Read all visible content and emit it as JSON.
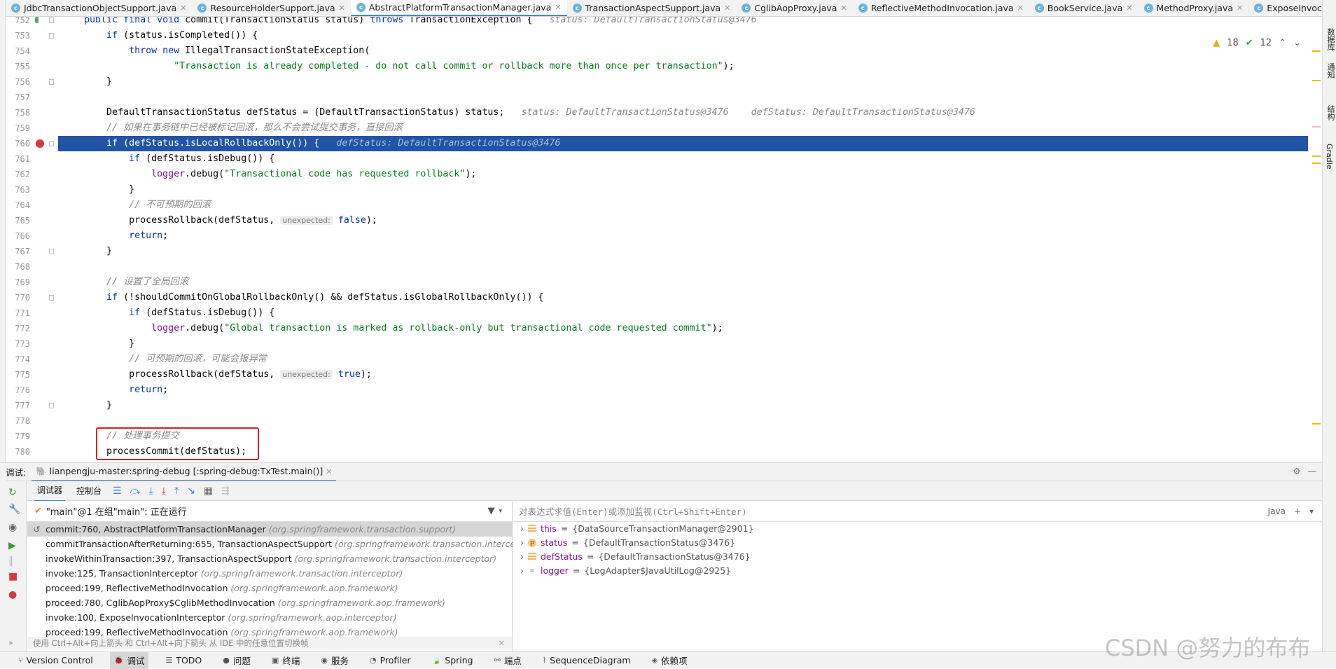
{
  "tabs": [
    {
      "label": "JdbcTransactionObjectSupport.java",
      "active": false
    },
    {
      "label": "ResourceHolderSupport.java",
      "active": false
    },
    {
      "label": "AbstractPlatformTransactionManager.java",
      "active": true
    },
    {
      "label": "TransactionAspectSupport.java",
      "active": false
    },
    {
      "label": "CglibAopProxy.java",
      "active": false
    },
    {
      "label": "ReflectiveMethodInvocation.java",
      "active": false
    },
    {
      "label": "BookService.java",
      "active": false
    },
    {
      "label": "MethodProxy.java",
      "active": false
    },
    {
      "label": "ExposeInvoc",
      "active": false
    }
  ],
  "inspections": {
    "warnings": "18",
    "ok": "12"
  },
  "right_tools": [
    "数据库",
    "通知",
    "结构",
    "Gradle"
  ],
  "editor": {
    "current_line": 760,
    "lines": [
      {
        "n": "752",
        "mark": "impl",
        "t": [
          [
            "    "
          ],
          [
            "public final void ",
            "kw"
          ],
          [
            "commit(TransactionStatus status) "
          ],
          [
            "throws ",
            "kw"
          ],
          [
            "TransactionException {"
          ],
          [
            "   status: DefaultTransactionStatus@3476",
            "hint"
          ]
        ]
      },
      {
        "n": "753",
        "t": [
          [
            "        "
          ],
          [
            "if ",
            "kw"
          ],
          [
            "(status.isCompleted()) {"
          ]
        ]
      },
      {
        "n": "754",
        "t": [
          [
            "            "
          ],
          [
            "throw new ",
            "kw"
          ],
          [
            "IllegalTransactionStateException("
          ]
        ]
      },
      {
        "n": "755",
        "t": [
          [
            "                    "
          ],
          [
            "\"Transaction is already completed - do not call commit or rollback more than once per transaction\"",
            "str"
          ],
          [
            ");"
          ]
        ]
      },
      {
        "n": "756",
        "t": [
          [
            "        }"
          ]
        ]
      },
      {
        "n": "757",
        "t": []
      },
      {
        "n": "758",
        "t": [
          [
            "        DefaultTransactionStatus defStatus = (DefaultTransactionStatus) status;"
          ],
          [
            "   status: DefaultTransactionStatus@3476    defStatus: DefaultTransactionStatus@3476",
            "hint"
          ]
        ]
      },
      {
        "n": "759",
        "t": [
          [
            "        "
          ],
          [
            "// 如果在事务链中已经被标记回滚，那么不会尝试提交事务，直接回滚",
            "cm"
          ]
        ]
      },
      {
        "n": "760",
        "mark": "bp",
        "t": [
          [
            "        "
          ],
          [
            "if ",
            "kw"
          ],
          [
            "(defStatus.isLocalRollbackOnly()) {"
          ],
          [
            "   defStatus: DefaultTransactionStatus@3476",
            "hint"
          ]
        ]
      },
      {
        "n": "761",
        "t": [
          [
            "            "
          ],
          [
            "if ",
            "kw"
          ],
          [
            "(defStatus.isDebug()) {"
          ]
        ]
      },
      {
        "n": "762",
        "t": [
          [
            "                "
          ],
          [
            "logger",
            "fld"
          ],
          [
            ".debug("
          ],
          [
            "\"Transactional code has requested rollback\"",
            "str"
          ],
          [
            ");"
          ]
        ]
      },
      {
        "n": "763",
        "t": [
          [
            "            }"
          ]
        ]
      },
      {
        "n": "764",
        "t": [
          [
            "            "
          ],
          [
            "// 不可预期的回滚",
            "cm"
          ]
        ]
      },
      {
        "n": "765",
        "t": [
          [
            "            processRollback(defStatus, "
          ],
          [
            "unexpected:",
            "chip"
          ],
          [
            " "
          ],
          [
            "false",
            "kw"
          ],
          [
            ");"
          ]
        ]
      },
      {
        "n": "766",
        "t": [
          [
            "            "
          ],
          [
            "return",
            "kw"
          ],
          [
            ";"
          ]
        ]
      },
      {
        "n": "767",
        "t": [
          [
            "        }"
          ]
        ]
      },
      {
        "n": "768",
        "t": []
      },
      {
        "n": "769",
        "t": [
          [
            "        "
          ],
          [
            "// 设置了全局回滚",
            "cm"
          ]
        ]
      },
      {
        "n": "770",
        "t": [
          [
            "        "
          ],
          [
            "if ",
            "kw"
          ],
          [
            "(!shouldCommitOnGlobalRollbackOnly() && defStatus.isGlobalRollbackOnly()) {"
          ]
        ]
      },
      {
        "n": "771",
        "t": [
          [
            "            "
          ],
          [
            "if ",
            "kw"
          ],
          [
            "(defStatus.isDebug()) {"
          ]
        ]
      },
      {
        "n": "772",
        "t": [
          [
            "                "
          ],
          [
            "logger",
            "fld"
          ],
          [
            ".debug("
          ],
          [
            "\"Global transaction is marked as rollback-only but transactional code requested commit\"",
            "str"
          ],
          [
            ");"
          ]
        ]
      },
      {
        "n": "773",
        "t": [
          [
            "            }"
          ]
        ]
      },
      {
        "n": "774",
        "t": [
          [
            "            "
          ],
          [
            "// 可预期的回滚，可能会报异常",
            "cm"
          ]
        ]
      },
      {
        "n": "775",
        "t": [
          [
            "            processRollback(defStatus, "
          ],
          [
            "unexpected:",
            "chip"
          ],
          [
            " "
          ],
          [
            "true",
            "kw"
          ],
          [
            ");"
          ]
        ]
      },
      {
        "n": "776",
        "t": [
          [
            "            "
          ],
          [
            "return",
            "kw"
          ],
          [
            ";"
          ]
        ]
      },
      {
        "n": "777",
        "t": [
          [
            "        }"
          ]
        ]
      },
      {
        "n": "778",
        "t": []
      },
      {
        "n": "779",
        "t": [
          [
            "        "
          ],
          [
            "// 处理事务提交",
            "cm"
          ]
        ]
      },
      {
        "n": "780",
        "t": [
          [
            "        processCommit(defStatus);"
          ]
        ]
      }
    ]
  },
  "debug": {
    "label": "调试:",
    "run_config": "lianpengju-master:spring-debug [:spring-debug:TxTest.main()]",
    "tabs": [
      "调试器",
      "控制台"
    ],
    "thread": "\"main\"@1 在组\"main\": 正在运行",
    "frames": [
      {
        "m": "commit:760, AbstractPlatformTransactionManager",
        "p": "(org.springframework.transaction.support)"
      },
      {
        "m": "commitTransactionAfterReturning:655, TransactionAspectSupport",
        "p": "(org.springframework.transaction.interceptor)"
      },
      {
        "m": "invokeWithinTransaction:397, TransactionAspectSupport",
        "p": "(org.springframework.transaction.interceptor)"
      },
      {
        "m": "invoke:125, TransactionInterceptor",
        "p": "(org.springframework.transaction.interceptor)"
      },
      {
        "m": "proceed:199, ReflectiveMethodInvocation",
        "p": "(org.springframework.aop.framework)"
      },
      {
        "m": "proceed:780, CglibAopProxy$CglibMethodInvocation",
        "p": "(org.springframework.aop.framework)"
      },
      {
        "m": "invoke:100, ExposeInvocationInterceptor",
        "p": "(org.springframework.aop.interceptor)"
      },
      {
        "m": "proceed:199, ReflectiveMethodInvocation",
        "p": "(org.springframework.aop.framework)"
      }
    ],
    "frames_hint": "使用 Ctrl+Alt+向上箭头 和 Ctrl+Alt+向下箭头 从 IDE 中的任意位置切换帧",
    "eval_placeholder": "对表达式求值(Enter)或添加监视(Ctrl+Shift+Enter)",
    "lang": "Java",
    "variables": [
      {
        "name": "this",
        "value": "{DataSourceTransactionManager@2901}",
        "icon": "field"
      },
      {
        "name": "status",
        "value": "{DefaultTransactionStatus@3476}",
        "icon": "param"
      },
      {
        "name": "defStatus",
        "value": "{DefaultTransactionStatus@3476}",
        "icon": "field"
      },
      {
        "name": "logger",
        "value": "{LogAdapter$JavaUtilLog@2925}",
        "icon": "static"
      }
    ]
  },
  "statusbar": [
    {
      "label": "Version Control",
      "icon": "branch"
    },
    {
      "label": "调试",
      "icon": "bug",
      "active": true
    },
    {
      "label": "TODO",
      "icon": "list"
    },
    {
      "label": "问题",
      "icon": "alert"
    },
    {
      "label": "终端",
      "icon": "terminal"
    },
    {
      "label": "服务",
      "icon": "services"
    },
    {
      "label": "Profiler",
      "icon": "profiler"
    },
    {
      "label": "Spring",
      "icon": "spring"
    },
    {
      "label": "端点",
      "icon": "endpoints"
    },
    {
      "label": "SequenceDiagram",
      "icon": "sequence"
    },
    {
      "label": "依赖项",
      "icon": "dependencies"
    }
  ],
  "watermark": "CSDN @努力的布布",
  "colors": {
    "highlight": "#2154a5",
    "keyword": "#0033b3",
    "string": "#067d17",
    "field": "#871094",
    "annotation_box": "#e01d1d"
  }
}
